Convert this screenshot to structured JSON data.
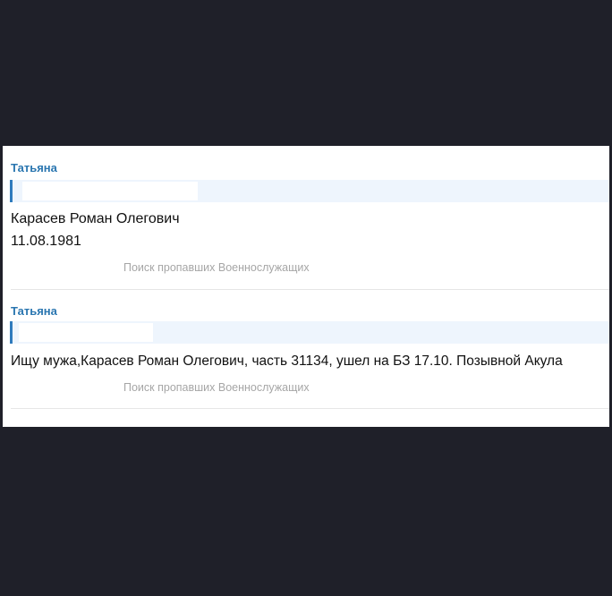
{
  "posts": [
    {
      "author": "Татьяна",
      "lines": [
        "Карасев Роман Олегович",
        "11.08.1981"
      ],
      "category": "Поиск пропавших Военнослужащих"
    },
    {
      "author": "Татьяна",
      "lines": [
        "Ищу мужа,Карасев Роман Олегович, часть 31134, ушел на БЗ 17.10. Позывной Акула"
      ],
      "category": "Поиск пропавших Военнослужащих"
    }
  ],
  "colors": {
    "page_background": "#1f2029",
    "author_link": "#2a76b0",
    "quote_background": "#eef5fd",
    "quote_border": "#2f7bbd",
    "category_text": "#a6a6a6"
  }
}
